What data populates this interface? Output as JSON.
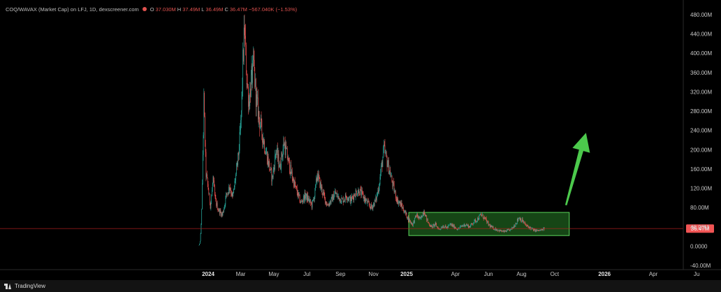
{
  "header": {
    "symbol": "COQ/WAVAX (Market Cap) on LFJ, 1D, dexscreener.com",
    "open_label": "O",
    "open": "37.030M",
    "high_label": "H",
    "high": "37.49M",
    "low_label": "L",
    "low": "36.49M",
    "close_label": "C",
    "close": "36.47M",
    "change": "−567.040K (−1.53%)"
  },
  "footer": {
    "brand": "TradingView"
  },
  "colors": {
    "background": "#000000",
    "up": "#26a69a",
    "down": "#ef5350",
    "zone_fill": "#1e5e1e",
    "zone_stroke": "#5cd65c",
    "arrow": "#4cc94c",
    "last_price_line": "#b22222",
    "last_price_label_bg": "#f05454"
  },
  "chart_data": {
    "type": "candlestick",
    "title": "COQ/WAVAX (Market Cap) on LFJ, 1D, dexscreener.com",
    "interval": "1D",
    "unit": "M",
    "x_range": [
      "2023-11-20",
      "2026-07-05"
    ],
    "ylim": [
      -40,
      480
    ],
    "y_ticks": [
      "480.00M",
      "440.00M",
      "400.00M",
      "360.00M",
      "320.00M",
      "280.00M",
      "240.00M",
      "200.00M",
      "160.00M",
      "120.00M",
      "80.00M",
      "40.00M",
      "0.0000",
      "-40.00M"
    ],
    "y_tick_values": [
      480,
      440,
      400,
      360,
      320,
      280,
      240,
      200,
      160,
      120,
      80,
      40,
      0,
      -40
    ],
    "x_ticks": [
      {
        "label": "2024",
        "date": "2024-01-01",
        "bold": true
      },
      {
        "label": "Mar",
        "date": "2024-03-01",
        "bold": false
      },
      {
        "label": "May",
        "date": "2024-05-01",
        "bold": false
      },
      {
        "label": "Jul",
        "date": "2024-07-01",
        "bold": false
      },
      {
        "label": "Sep",
        "date": "2024-09-01",
        "bold": false
      },
      {
        "label": "Nov",
        "date": "2024-11-01",
        "bold": false
      },
      {
        "label": "2025",
        "date": "2025-01-01",
        "bold": true
      },
      {
        "label": "Apr",
        "date": "2025-04-01",
        "bold": false
      },
      {
        "label": "Jun",
        "date": "2025-06-01",
        "bold": false
      },
      {
        "label": "Aug",
        "date": "2025-08-01",
        "bold": false
      },
      {
        "label": "Oct",
        "date": "2025-10-01",
        "bold": false
      },
      {
        "label": "2026",
        "date": "2026-01-01",
        "bold": true
      },
      {
        "label": "Apr",
        "date": "2026-04-01",
        "bold": false
      },
      {
        "label": "Ju",
        "date": "2026-06-20",
        "bold": false
      }
    ],
    "price_path": [
      [
        "2023-12-15",
        2
      ],
      [
        "2023-12-18",
        25
      ],
      [
        "2023-12-20",
        80
      ],
      [
        "2023-12-22",
        190
      ],
      [
        "2023-12-24",
        300
      ],
      [
        "2023-12-26",
        220
      ],
      [
        "2023-12-28",
        150
      ],
      [
        "2024-01-01",
        120
      ],
      [
        "2024-01-05",
        85
      ],
      [
        "2024-01-10",
        140
      ],
      [
        "2024-01-14",
        95
      ],
      [
        "2024-01-20",
        75
      ],
      [
        "2024-01-27",
        65
      ],
      [
        "2024-02-03",
        105
      ],
      [
        "2024-02-10",
        125
      ],
      [
        "2024-02-15",
        100
      ],
      [
        "2024-02-20",
        140
      ],
      [
        "2024-02-25",
        180
      ],
      [
        "2024-03-01",
        250
      ],
      [
        "2024-03-05",
        380
      ],
      [
        "2024-03-08",
        450
      ],
      [
        "2024-03-12",
        350
      ],
      [
        "2024-03-16",
        300
      ],
      [
        "2024-03-20",
        340
      ],
      [
        "2024-03-25",
        375
      ],
      [
        "2024-03-30",
        300
      ],
      [
        "2024-04-05",
        260
      ],
      [
        "2024-04-12",
        220
      ],
      [
        "2024-04-20",
        180
      ],
      [
        "2024-04-28",
        140
      ],
      [
        "2024-05-05",
        200
      ],
      [
        "2024-05-12",
        165
      ],
      [
        "2024-05-20",
        215
      ],
      [
        "2024-05-28",
        175
      ],
      [
        "2024-06-05",
        140
      ],
      [
        "2024-06-12",
        115
      ],
      [
        "2024-06-20",
        90
      ],
      [
        "2024-06-28",
        105
      ],
      [
        "2024-07-05",
        95
      ],
      [
        "2024-07-10",
        85
      ],
      [
        "2024-07-15",
        105
      ],
      [
        "2024-07-20",
        150
      ],
      [
        "2024-07-25",
        130
      ],
      [
        "2024-08-01",
        105
      ],
      [
        "2024-08-08",
        85
      ],
      [
        "2024-08-15",
        95
      ],
      [
        "2024-08-22",
        110
      ],
      [
        "2024-08-29",
        100
      ],
      [
        "2024-09-05",
        95
      ],
      [
        "2024-09-12",
        105
      ],
      [
        "2024-09-20",
        95
      ],
      [
        "2024-09-28",
        110
      ],
      [
        "2024-10-05",
        115
      ],
      [
        "2024-10-12",
        105
      ],
      [
        "2024-10-20",
        90
      ],
      [
        "2024-10-28",
        80
      ],
      [
        "2024-11-05",
        95
      ],
      [
        "2024-11-10",
        120
      ],
      [
        "2024-11-15",
        160
      ],
      [
        "2024-11-20",
        200
      ],
      [
        "2024-11-25",
        180
      ],
      [
        "2024-12-01",
        155
      ],
      [
        "2024-12-08",
        120
      ],
      [
        "2024-12-15",
        95
      ],
      [
        "2024-12-22",
        85
      ],
      [
        "2024-12-29",
        70
      ],
      [
        "2025-01-05",
        55
      ],
      [
        "2025-01-12",
        45
      ],
      [
        "2025-01-19",
        65
      ],
      [
        "2025-01-26",
        55
      ],
      [
        "2025-02-02",
        75
      ],
      [
        "2025-02-09",
        50
      ],
      [
        "2025-02-16",
        40
      ],
      [
        "2025-02-23",
        45
      ],
      [
        "2025-03-02",
        35
      ],
      [
        "2025-03-09",
        42
      ],
      [
        "2025-03-16",
        38
      ],
      [
        "2025-03-23",
        45
      ],
      [
        "2025-03-30",
        40
      ],
      [
        "2025-04-06",
        35
      ],
      [
        "2025-04-13",
        42
      ],
      [
        "2025-04-20",
        45
      ],
      [
        "2025-04-27",
        40
      ],
      [
        "2025-05-04",
        50
      ],
      [
        "2025-05-11",
        55
      ],
      [
        "2025-05-18",
        65
      ],
      [
        "2025-05-25",
        58
      ],
      [
        "2025-06-01",
        45
      ],
      [
        "2025-06-08",
        38
      ],
      [
        "2025-06-15",
        35
      ],
      [
        "2025-06-22",
        32
      ],
      [
        "2025-06-29",
        30
      ],
      [
        "2025-07-06",
        32
      ],
      [
        "2025-07-13",
        35
      ],
      [
        "2025-07-20",
        45
      ],
      [
        "2025-07-27",
        60
      ],
      [
        "2025-08-03",
        52
      ],
      [
        "2025-08-10",
        42
      ],
      [
        "2025-08-17",
        38
      ],
      [
        "2025-08-24",
        33
      ],
      [
        "2025-08-31",
        32
      ],
      [
        "2025-09-07",
        33
      ],
      [
        "2025-09-12",
        36.47
      ]
    ],
    "annotations": {
      "last_price": 36.47,
      "last_price_label": "36.47M",
      "accumulation_zone": {
        "start": "2025-01-05",
        "end": "2025-10-28",
        "low": 22,
        "high": 70
      },
      "arrow": {
        "from": [
          "2025-10-22",
          85
        ],
        "to": [
          "2025-11-28",
          235
        ],
        "direction": "up"
      }
    }
  }
}
